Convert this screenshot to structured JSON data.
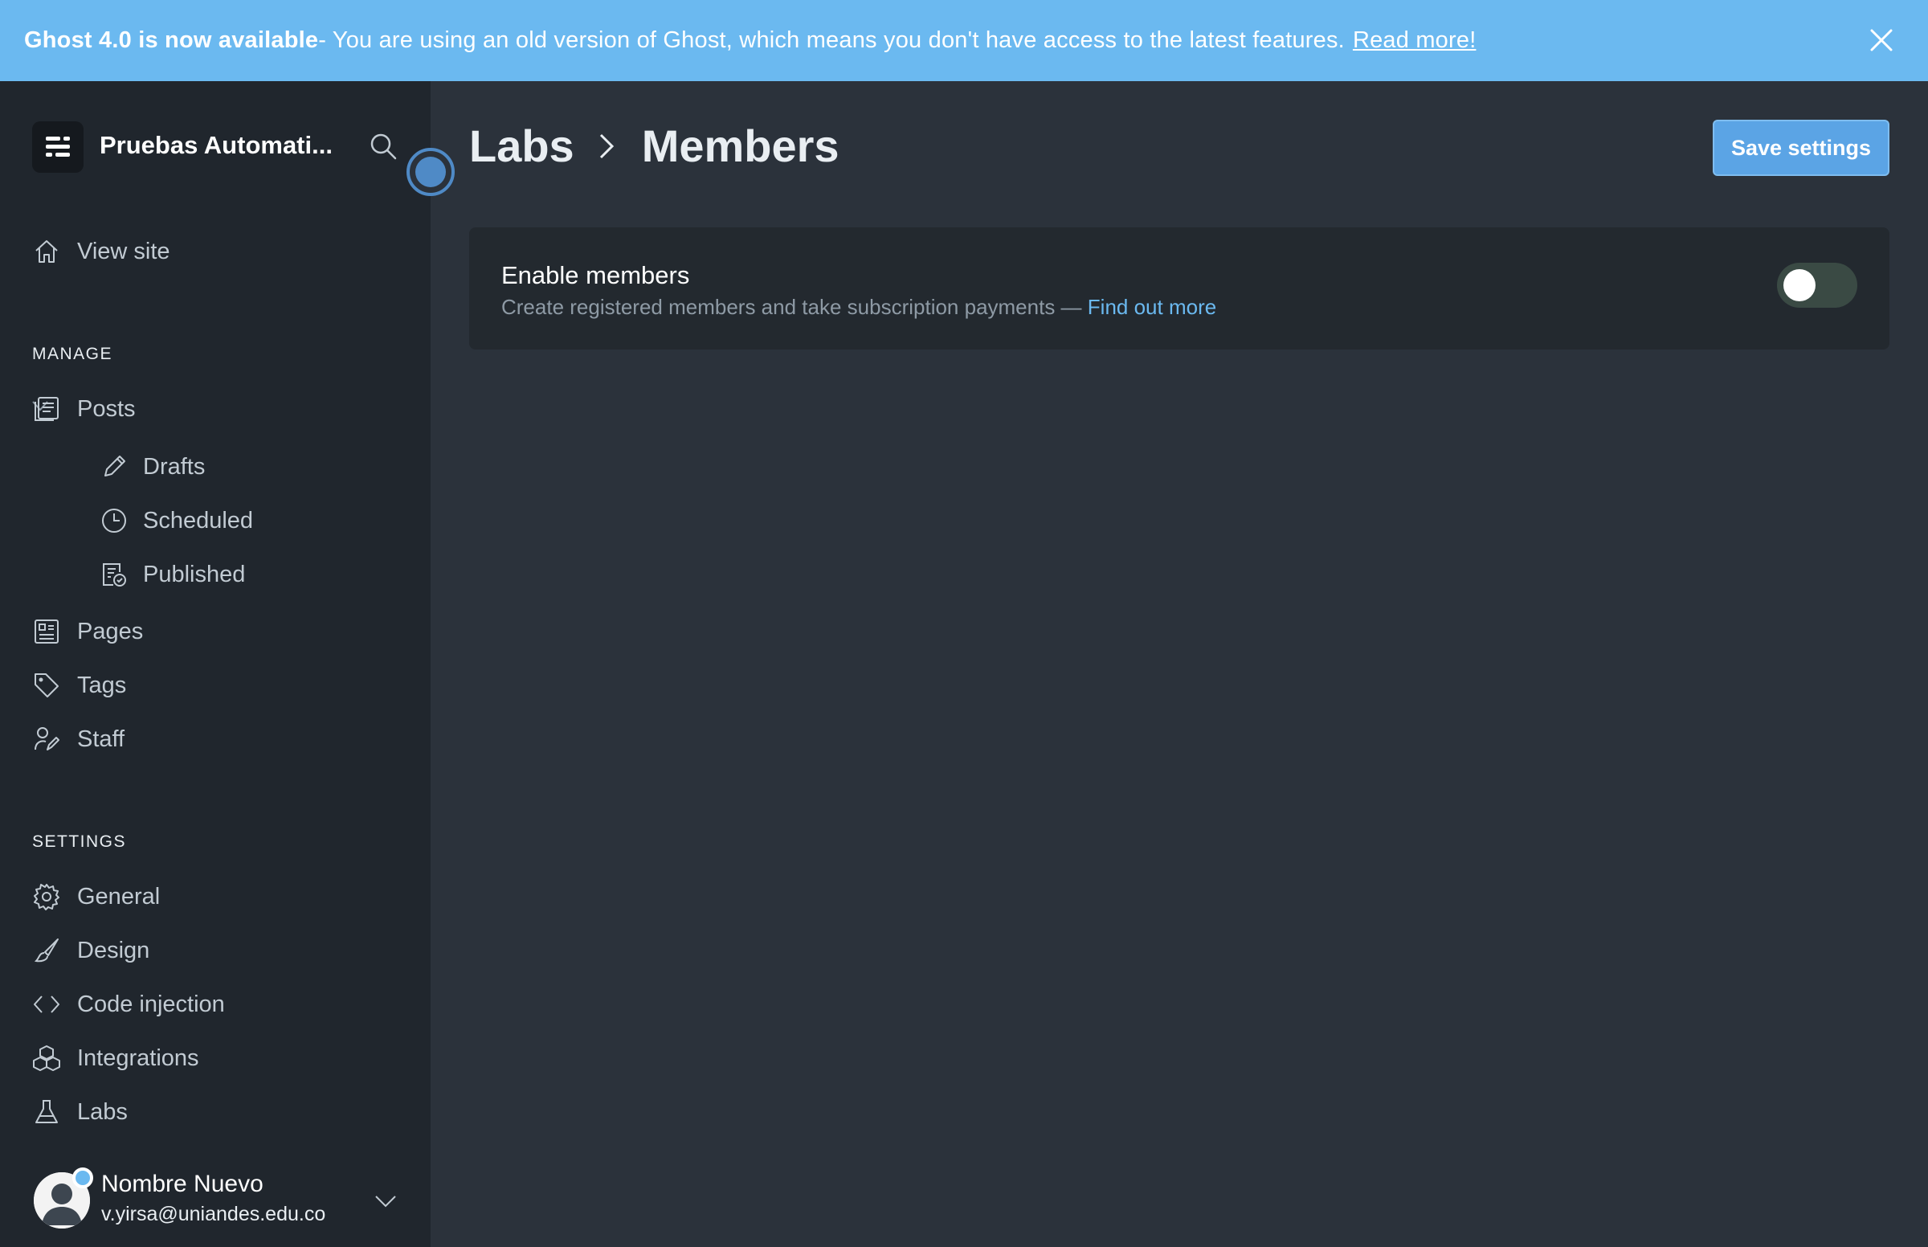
{
  "banner": {
    "title": "Ghost 4.0 is now available",
    "message": " - You are using an old version of Ghost, which means you don't have access to the latest features.",
    "link": "Read more!"
  },
  "sidebar": {
    "site_title": "Pruebas Automati...",
    "view_site": "View site",
    "manage_label": "MANAGE",
    "settings_label": "SETTINGS",
    "posts": "Posts",
    "drafts": "Drafts",
    "scheduled": "Scheduled",
    "published": "Published",
    "pages": "Pages",
    "tags": "Tags",
    "staff": "Staff",
    "general": "General",
    "design": "Design",
    "code_injection": "Code injection",
    "integrations": "Integrations",
    "labs": "Labs"
  },
  "user": {
    "name": "Nombre Nuevo",
    "email": "v.yirsa@uniandes.edu.co"
  },
  "main": {
    "breadcrumb_parent": "Labs",
    "breadcrumb_current": "Members",
    "save_label": "Save settings",
    "card": {
      "title": "Enable members",
      "description": "Create registered members and take subscription payments — ",
      "link": "Find out more",
      "enabled": false
    }
  },
  "colors": {
    "banner": "#6bb9f0",
    "sidebar": "#20262d",
    "main": "#2b323b",
    "accent": "#5ba4e5"
  }
}
